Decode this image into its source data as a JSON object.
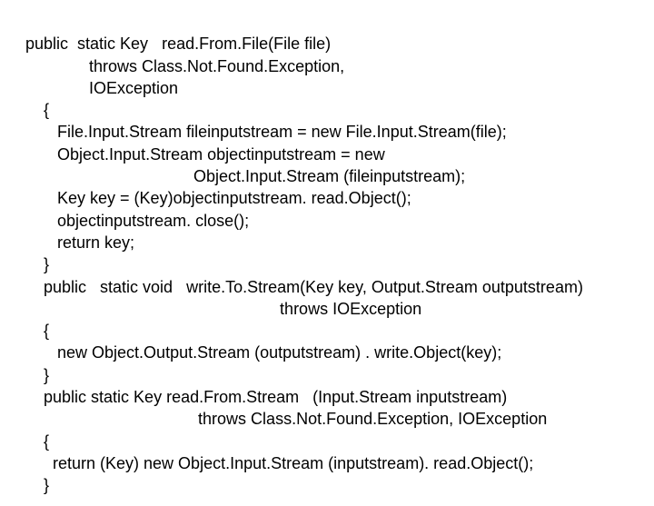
{
  "lines": {
    "l1a": "public  static Key   ",
    "l1b": "read.From.File",
    "l1c": "(File ",
    "l1d": "file",
    "l1e": ")",
    "l2": "              throws Class.Not.Found.Exception,",
    "l3": "              IOException",
    "l4": "    {",
    "l5a": "       File.Input.Stream ",
    "l5b": "fileinputstream",
    "l5c": " = new File.Input.Stream(",
    "l5d": "file",
    "l5e": ");",
    "l6a": "       Object.Input.Stream ",
    "l6b": "objectinputstream",
    "l6c": " = new",
    "l7a": "                                     Object.Input.Stream (",
    "l7b": "fileinputstream",
    "l7c": ");",
    "l8a": "       Key ",
    "l8b": "key",
    "l8c": " = (Key)",
    "l8d": "objectinputstream",
    "l8e": ". read.Object();",
    "l9a": "       ",
    "l9b": "objectinputstream",
    "l9c": ". close();",
    "l10a": "       return ",
    "l10b": "key",
    "l10c": ";",
    "l11": "    }",
    "l12a": "    public   static void   ",
    "l12b": "write.To.Stream",
    "l12c": "(Key ",
    "l12d": "key",
    "l12e": ", Output.Stream ",
    "l12f": "outputstream",
    "l12g": ")",
    "l13": "                                                        throws IOException",
    "l14": "    {",
    "l15a": "       new Object.Output.Stream (",
    "l15b": "outputstream",
    "l15c": ") . ",
    "l15d": "write.Object",
    "l15e": "(",
    "l15f": "key",
    "l15g": ");",
    "l16": "    }",
    "l17a": "    public static Key ",
    "l17b": "read.From.Stream   ",
    "l17c": "(Input.Stream ",
    "l17d": "inputstream",
    "l17e": ")",
    "l18": "                                      throws Class.Not.Found.Exception, IOException",
    "l19": "    {",
    "l20a": "      return (Key) new Object.Input.Stream (",
    "l20b": "inputstream",
    "l20c": "). read.Object();",
    "l21": "    }"
  }
}
